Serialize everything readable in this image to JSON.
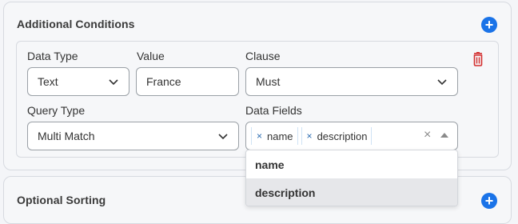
{
  "additional_conditions": {
    "title": "Additional Conditions",
    "add_icon": "plus-icon",
    "condition": {
      "data_type_label": "Data Type",
      "data_type_value": "Text",
      "value_label": "Value",
      "value_value": "France",
      "clause_label": "Clause",
      "clause_value": "Must",
      "query_type_label": "Query Type",
      "query_type_value": "Multi Match",
      "data_fields_label": "Data Fields",
      "data_fields_selected": [
        "name",
        "description"
      ],
      "delete_icon": "trash-icon"
    },
    "data_fields_menu": [
      "name",
      "description"
    ]
  },
  "optional_sorting": {
    "title": "Optional Sorting",
    "add_icon": "plus-icon"
  },
  "colors": {
    "accent": "#1a73e8",
    "delete": "#d32f2f",
    "chip_border": "#cfe3f5"
  }
}
